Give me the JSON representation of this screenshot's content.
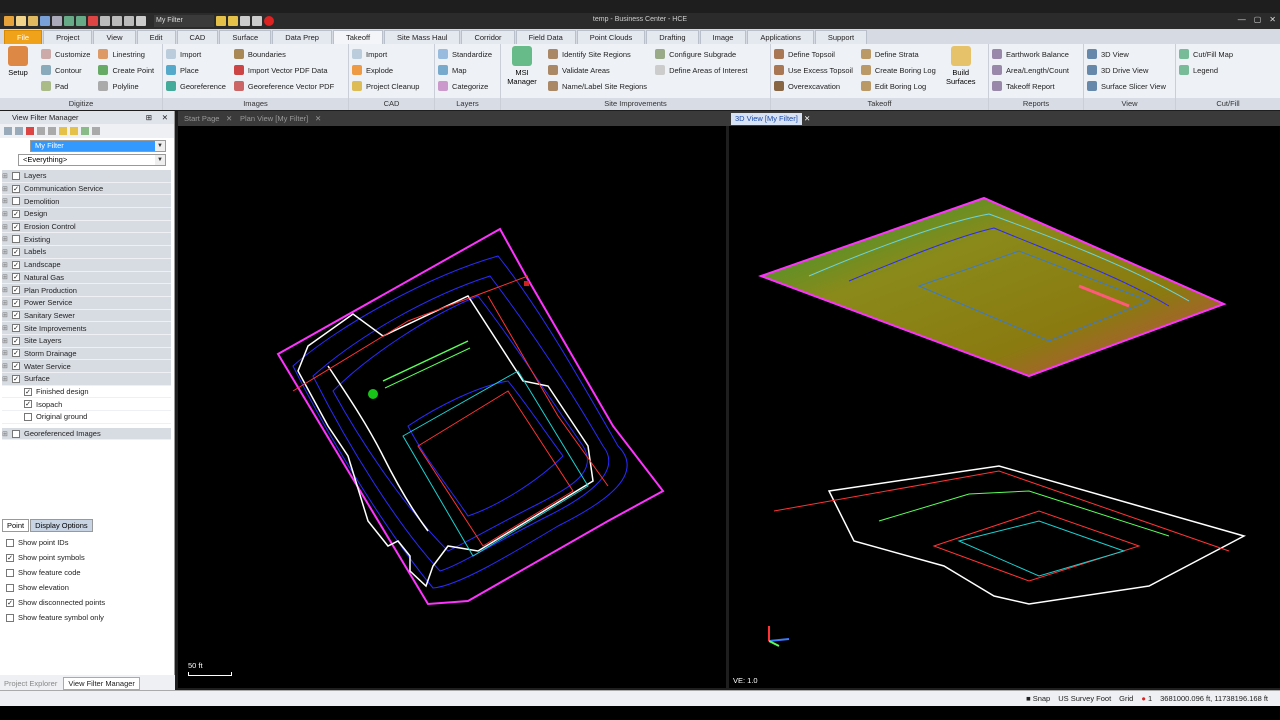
{
  "app_title": "temp - Business Center - HCE",
  "quick_access": {
    "filter": "My Filter"
  },
  "menu_tabs": [
    "File",
    "Project",
    "View",
    "Edit",
    "CAD",
    "Surface",
    "Data Prep",
    "Takeoff",
    "Site Mass Haul",
    "Corridor",
    "Field Data",
    "Point Clouds",
    "Drafting",
    "Image",
    "Applications",
    "Support"
  ],
  "ribbon": {
    "digitize": {
      "label": "Digitize",
      "setup": "Setup",
      "customize": "Customize",
      "contour": "Contour",
      "pad": "Pad",
      "linestring": "Linestring",
      "create_point": "Create Point",
      "polyline": "Polyline"
    },
    "images": {
      "label": "Images",
      "import": "Import",
      "place": "Place",
      "georeference": "Georeference",
      "boundaries": "Boundaries",
      "import_vector": "Import Vector PDF Data",
      "georef_vector": "Georeference Vector PDF"
    },
    "cad": {
      "label": "CAD",
      "import": "Import",
      "explode": "Explode",
      "project_cleanup": "Project Cleanup"
    },
    "layers": {
      "label": "Layers",
      "standardize": "Standardize",
      "map": "Map",
      "categorize": "Categorize"
    },
    "site_improvements": {
      "label": "Site Improvements",
      "msi_manager": "MSI Manager",
      "identify": "Identify Site Regions",
      "validate": "Validate Areas",
      "name_label": "Name/Label Site Regions",
      "configure": "Configure Subgrade",
      "define_areas": "Define Areas of Interest"
    },
    "takeoff": {
      "label": "Takeoff",
      "define_topsoil": "Define Topsoil",
      "use_excess": "Use Excess Topsoil",
      "overexcavation": "Overexcavation",
      "define_strata": "Define Strata",
      "create_boring": "Create Boring Log",
      "edit_boring": "Edit Boring Log",
      "build_surfaces": "Build Surfaces"
    },
    "reports": {
      "label": "Reports",
      "earthwork": "Earthwork Balance",
      "area": "Area/Length/Count",
      "takeoff_report": "Takeoff Report"
    },
    "view": {
      "label": "View",
      "view3d": "3D View",
      "drive": "3D Drive View",
      "slicer": "Surface Slicer View"
    },
    "cutfill": {
      "label": "Cut/Fill",
      "map": "Cut/Fill Map",
      "legend": "Legend"
    }
  },
  "left_panel": {
    "title": "View Filter Manager",
    "filter_value": "My Filter",
    "everything_value": "<Everything>",
    "layers": [
      {
        "label": "Layers",
        "checked": false
      },
      {
        "label": "Communication Service",
        "checked": true
      },
      {
        "label": "Demolition",
        "checked": false
      },
      {
        "label": "Design",
        "checked": true
      },
      {
        "label": "Erosion Control",
        "checked": true
      },
      {
        "label": "Existing",
        "checked": false
      },
      {
        "label": "Labels",
        "checked": true
      },
      {
        "label": "Landscape",
        "checked": true
      },
      {
        "label": "Natural Gas",
        "checked": true
      },
      {
        "label": "Plan Production",
        "checked": true
      },
      {
        "label": "Power Service",
        "checked": true
      },
      {
        "label": "Sanitary Sewer",
        "checked": true
      },
      {
        "label": "Site Improvements",
        "checked": true
      },
      {
        "label": "Site Layers",
        "checked": true
      },
      {
        "label": "Storm Drainage",
        "checked": true
      },
      {
        "label": "Water Service",
        "checked": true
      },
      {
        "label": "Surface",
        "checked": true
      }
    ],
    "surface_children": [
      {
        "label": "Finished design",
        "checked": true
      },
      {
        "label": "Isopach",
        "checked": true
      },
      {
        "label": "Original ground",
        "checked": false
      }
    ],
    "georef": {
      "label": "Georeferenced Images",
      "checked": false
    },
    "tabs": [
      "Point",
      "Display Options"
    ],
    "point_options": [
      {
        "label": "Show point IDs",
        "checked": false
      },
      {
        "label": "Show point symbols",
        "checked": true
      },
      {
        "label": "Show feature code",
        "checked": false
      },
      {
        "label": "Show elevation",
        "checked": false
      },
      {
        "label": "Show disconnected points",
        "checked": true
      },
      {
        "label": "Show feature symbol only",
        "checked": false
      }
    ],
    "bottom_tabs": [
      "Project Explorer",
      "View Filter Manager"
    ]
  },
  "doc_tabs": {
    "start": "Start Page",
    "plan": "Plan View [My Filter]",
    "view3d": "3D View [My Filter]"
  },
  "plan_scale": "50 ft",
  "view3d_ve": "VE: 1.0",
  "status": {
    "snap": "Snap",
    "units": "US Survey Foot",
    "grid": "Grid",
    "count": "1",
    "coords": "3681000.096 ft, 11738196.168 ft"
  },
  "colors": {
    "accent": "#f0a21a",
    "boundary": "#ff33ff",
    "contour": "#2a2aff",
    "site": "#ffffff"
  }
}
